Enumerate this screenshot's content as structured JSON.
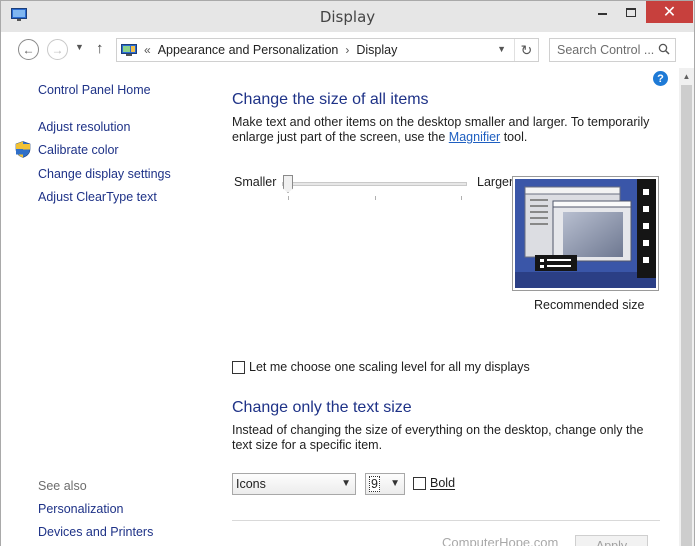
{
  "window": {
    "title": "Display"
  },
  "titlebar": {
    "minimize_label": "",
    "maximize_label": "",
    "close_label": "✕"
  },
  "address": {
    "overflow": "«",
    "crumbs": [
      "Appearance and Personalization",
      "Display"
    ]
  },
  "search": {
    "placeholder": "Search Control ..."
  },
  "leftnav": {
    "home": "Control Panel Home",
    "items": [
      "Adjust resolution",
      "Calibrate color",
      "Change display settings",
      "Adjust ClearType text"
    ],
    "see_also": "See also",
    "see_also_items": [
      "Personalization",
      "Devices and Printers"
    ]
  },
  "main": {
    "section1_title": "Change the size of all items",
    "section1_text_pre": "Make text and other items on the desktop smaller and larger. To temporarily enlarge just part of the screen, use the ",
    "section1_link": "Magnifier",
    "section1_text_post": " tool.",
    "slider_min_label": "Smaller",
    "slider_max_label": "Larger",
    "slider_value": 0,
    "preview_caption": "Recommended size",
    "scaling_checkbox_label": "Let me choose one scaling level for all my displays",
    "scaling_checked": false,
    "section2_title": "Change only the text size",
    "section2_text": "Instead of changing the size of everything on the desktop, change only the text size for a specific item.",
    "item_select_value": "Icons",
    "size_select_value": "9",
    "bold_label": "Bold",
    "bold_checked": false,
    "apply_label": "Apply"
  },
  "watermark": "ComputerHope.com",
  "colors": {
    "link": "#1e3287",
    "heading": "#1e3287",
    "close_button": "#c7403d",
    "preview_blue": "#3a56a8"
  },
  "icons": [
    "display-app-icon",
    "back-icon",
    "forward-icon",
    "up-icon",
    "control-panel-icon",
    "refresh-icon",
    "search-icon",
    "shield-icon",
    "help-icon"
  ]
}
